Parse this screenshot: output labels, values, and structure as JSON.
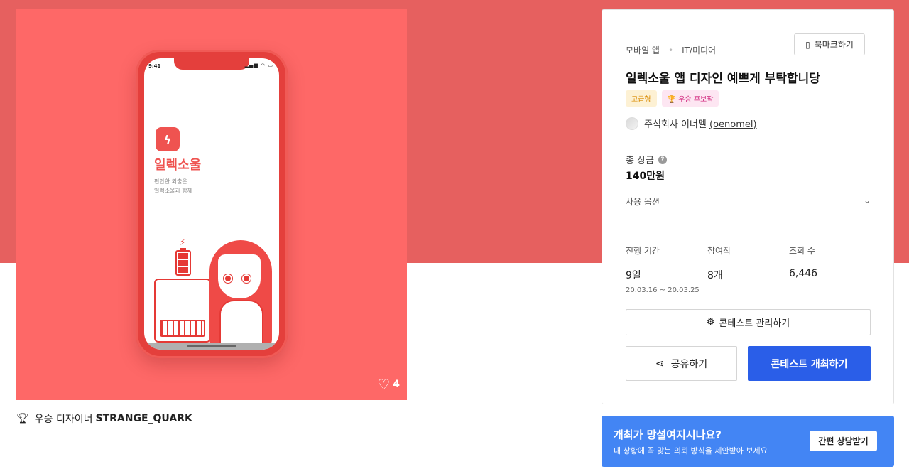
{
  "preview": {
    "phone": {
      "time": "9:41",
      "app_name": "일렉소울",
      "tagline_1": "편안한 외출은",
      "tagline_2": "일렉소울과 함께"
    },
    "likes": "4"
  },
  "winner": {
    "label": "우승 디자이너",
    "name": "STRANGE_QUARK"
  },
  "card": {
    "category_1": "모바일 앱",
    "category_2": "IT/미디어",
    "bookmark_label": "북마크하기",
    "title": "일렉소울 앱 디자인 예쁘게 부탁합니당",
    "badge_grade": "고급형",
    "badge_award": "우승 후보작",
    "host_name": "주식회사 이너멜",
    "host_handle": "(oenomel)",
    "prize_label": "총 상금",
    "prize_value": "140만원",
    "usage_label": "사용 옵션",
    "stats": {
      "period_label": "진행 기간",
      "period_value": "9일",
      "period_range": "20.03.16 ~ 20.03.25",
      "entries_label": "참여작",
      "entries_value": "8개",
      "views_label": "조회 수",
      "views_value": "6,446"
    },
    "manage_label": "콘테스트 관리하기",
    "share_label": "공유하기",
    "host_button_label": "콘테스트 개최하기"
  },
  "consult": {
    "question": "개최가 망설여지시나요?",
    "desc": "내 상황에 꼭 맞는 의뢰 방식을 제안받아 보세요",
    "button_label": "간편 상담받기"
  },
  "colors": {
    "hero_band": "#e6605f",
    "preview_bg": "#fe6867",
    "primary_button": "#2a5ee8",
    "consult_bg": "#4385f4"
  }
}
